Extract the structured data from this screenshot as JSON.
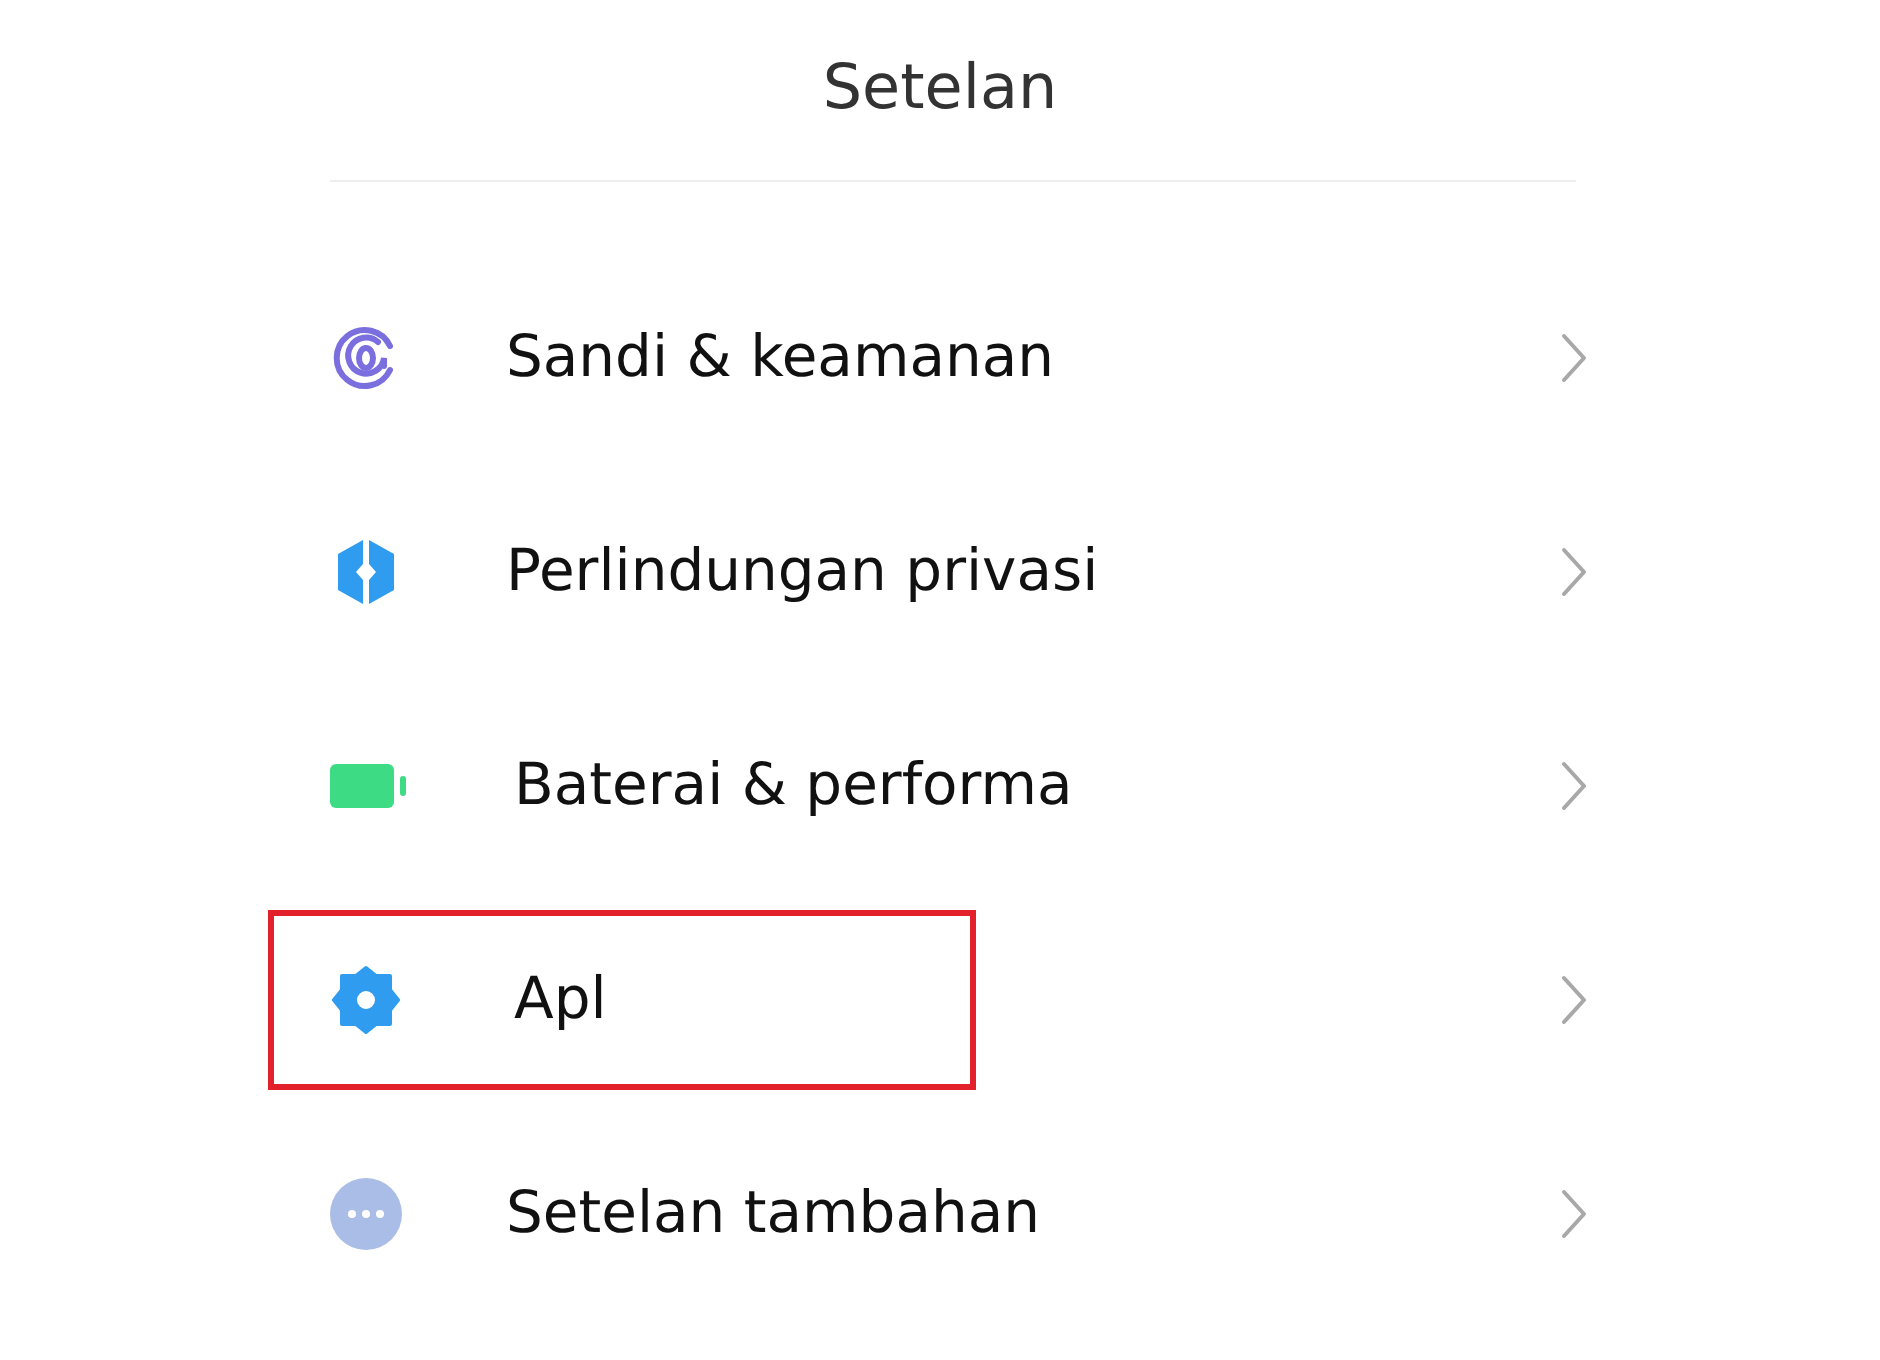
{
  "header": {
    "title": "Setelan"
  },
  "items": [
    {
      "kind": "fingerprint",
      "label": "Sandi & keamanan",
      "highlighted": false
    },
    {
      "kind": "privacy",
      "label": "Perlindungan privasi",
      "highlighted": false
    },
    {
      "kind": "battery",
      "label": "Baterai & performa",
      "highlighted": false
    },
    {
      "kind": "apps",
      "label": "Apl",
      "highlighted": true
    },
    {
      "kind": "more",
      "label": "Setelan tambahan",
      "highlighted": false
    }
  ]
}
